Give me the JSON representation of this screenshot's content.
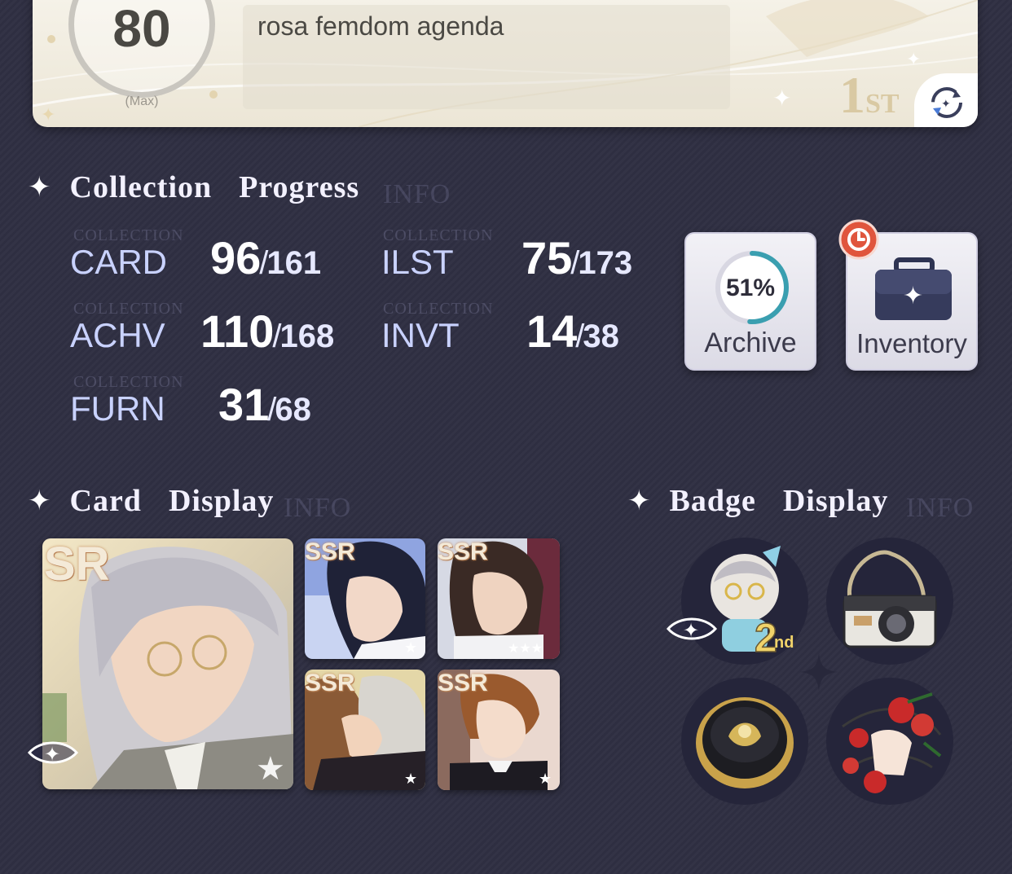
{
  "profile": {
    "level": "80",
    "level_note": "(Max)",
    "bio": "rosa femdom agenda",
    "rank_number": "1",
    "rank_suffix": "ST"
  },
  "collection": {
    "title": "Collection  Progress",
    "ghost": "INFO",
    "stat_ghost": "COLLECTION",
    "stats": [
      {
        "label": "CARD",
        "current": "96",
        "total": "161"
      },
      {
        "label": "ILST",
        "current": "75",
        "total": "173"
      },
      {
        "label": "ACHV",
        "current": "110",
        "total": "168"
      },
      {
        "label": "INVT",
        "current": "14",
        "total": "38"
      },
      {
        "label": "FURN",
        "current": "31",
        "total": "68"
      }
    ],
    "archive": {
      "percent_text": "51%",
      "percent_value": 51,
      "label": "Archive"
    },
    "inventory": {
      "label": "Inventory"
    }
  },
  "card_display": {
    "title": "Card  Display",
    "ghost": "INFO",
    "cards": [
      {
        "rarity": "SR"
      },
      {
        "rarity": "SSR"
      },
      {
        "rarity": "SSR"
      },
      {
        "rarity": "SSR"
      },
      {
        "rarity": "SSR"
      }
    ]
  },
  "badge_display": {
    "title": "Badge  Display",
    "ghost": "INFO",
    "badges": [
      {
        "name": "chibi-anniversary",
        "text": "2",
        "suffix": "nd"
      },
      {
        "name": "camera"
      },
      {
        "name": "gold-pin"
      },
      {
        "name": "rose-hands"
      }
    ]
  },
  "colors": {
    "background": "#2f2f42",
    "stat_label": "#c9d2ff",
    "archive_ring": "#3a9fb0",
    "inventory_alert": "#e0553d"
  }
}
